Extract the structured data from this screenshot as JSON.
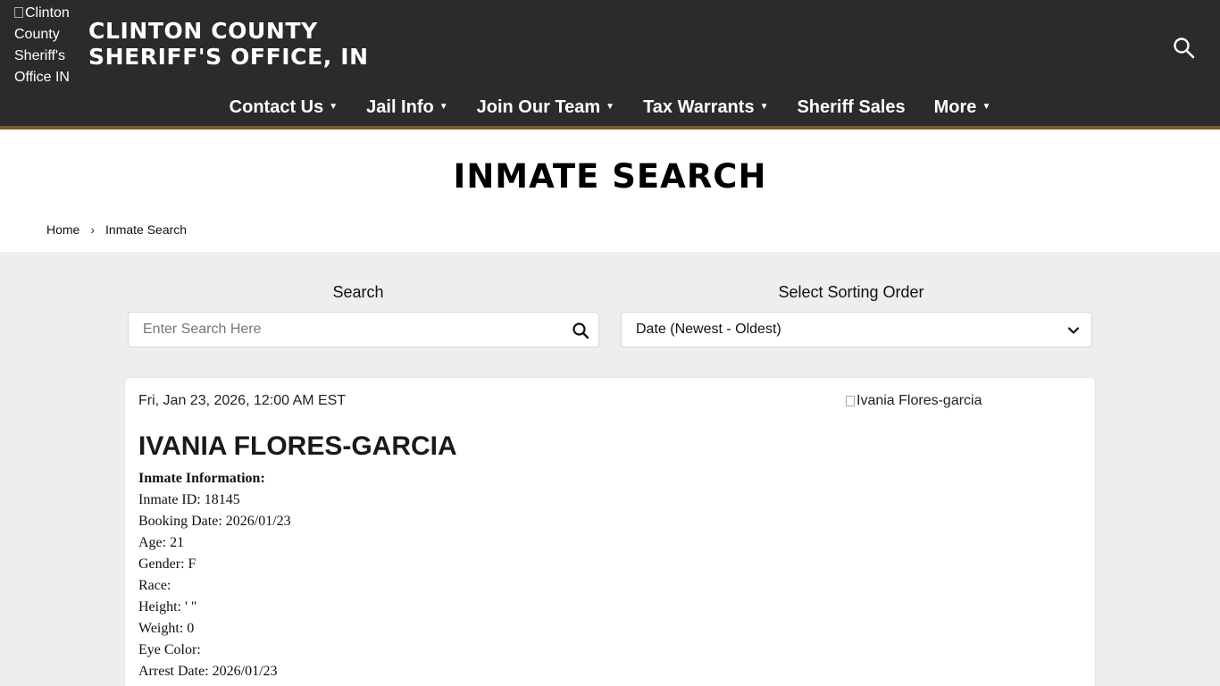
{
  "header": {
    "logo_alt": "Clinton County Sheriff's Office IN",
    "title_line1": "CLINTON COUNTY",
    "title_line2": "SHERIFF'S OFFICE, IN"
  },
  "nav": [
    {
      "label": "Contact Us",
      "dropdown": true
    },
    {
      "label": "Jail Info",
      "dropdown": true
    },
    {
      "label": "Join Our Team",
      "dropdown": true
    },
    {
      "label": "Tax Warrants",
      "dropdown": true
    },
    {
      "label": "Sheriff Sales",
      "dropdown": false
    },
    {
      "label": "More",
      "dropdown": true
    }
  ],
  "page": {
    "title": "INMATE SEARCH",
    "breadcrumb": {
      "home": "Home",
      "current": "Inmate Search"
    }
  },
  "search": {
    "label": "Search",
    "placeholder": "Enter Search Here",
    "value": ""
  },
  "sort": {
    "label": "Select Sorting Order",
    "selected": "Date (Newest - Oldest)"
  },
  "inmate": {
    "date": "Fri, Jan 23, 2026, 12:00 AM EST",
    "photo_alt": "Ivania Flores-garcia",
    "name": "IVANIA FLORES-GARCIA",
    "info_heading": "Inmate Information:",
    "fields": [
      "Inmate ID: 18145",
      "Booking Date: 2026/01/23",
      "Age: 21",
      "Gender: F",
      "Race:",
      "Height: ' \"",
      "Weight: 0",
      "Eye Color:",
      "Arrest Date: 2026/01/23"
    ]
  },
  "colors": {
    "header_bg": "#2b2b2b",
    "header_accent": "#7a5a32",
    "page_bg": "#eeeeee"
  }
}
